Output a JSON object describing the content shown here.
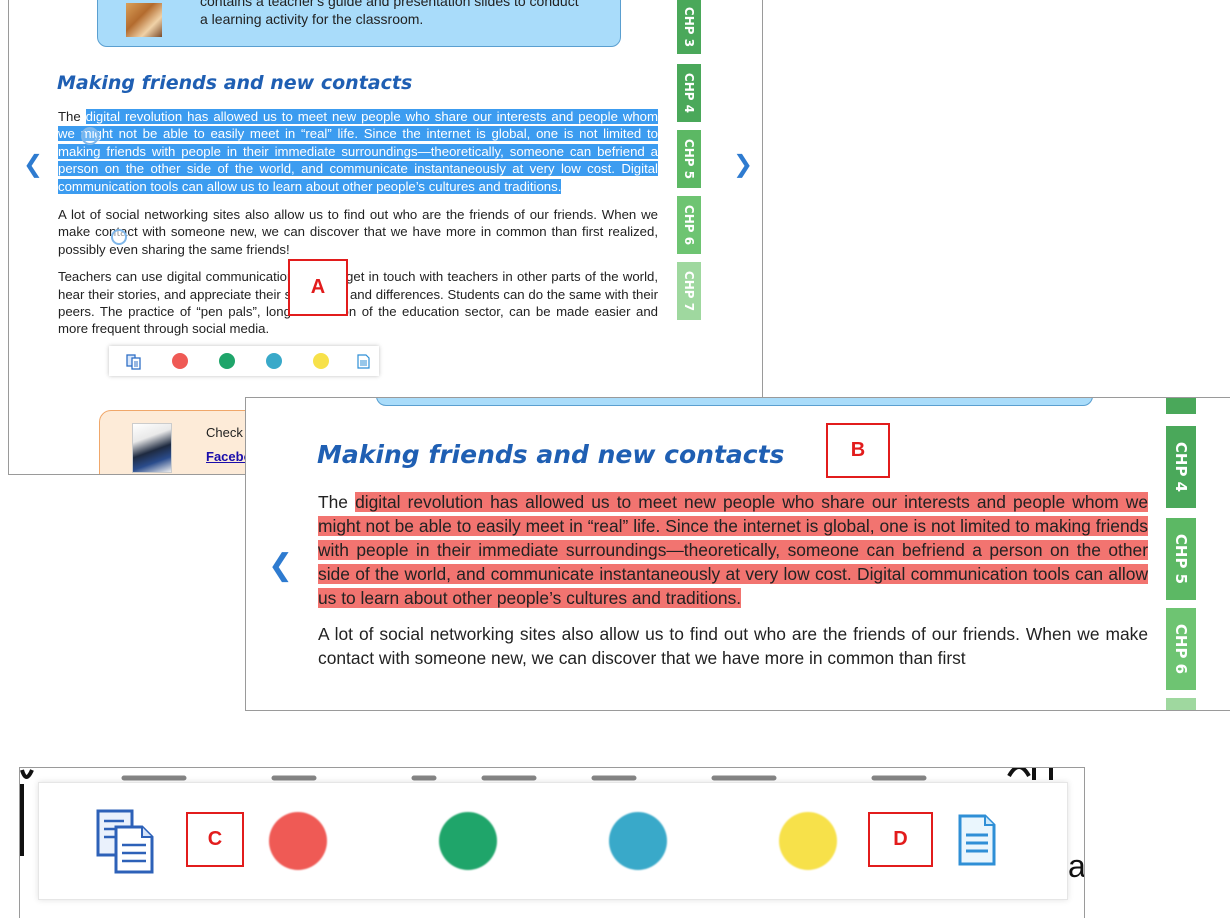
{
  "colors": {
    "title": "#1f5fb3",
    "highlight_blue": "#3c9cf0",
    "highlight_red": "#f27470",
    "chp_dark": "#4aa85a",
    "chp_light": "#8fd28f",
    "dot_red": "#ef5a55",
    "dot_green": "#1fa56a",
    "dot_teal": "#39a9c9",
    "dot_yellow": "#f7e14a",
    "label": "#e21c1c"
  },
  "panel_a": {
    "banner_line1": "contains a teacher's guide and presentation slides to conduct",
    "banner_line2": "a learning activity for the classroom.",
    "title": "Making friends and new contacts",
    "para1_pre": "The ",
    "para1_highlight": "digital revolution has allowed us to meet new people who share our interests and people whom we might not be able to easily meet in “real” life. Since the internet is global, one is not limited to making friends with people in their immediate surroundings—theoretically, someone can befriend a person on the other side of the world, and communicate instantaneously at very low cost. Digital communication tools can allow us to learn about other people’s cultures and traditions.",
    "para2": "A lot of social networking sites also allow us to find out who are the friends of our friends. When we make contact with someone new, we can discover that we have more in common than first realized, possibly even sharing the same friends!",
    "para3": "Teachers can use digital communication tools to get in touch with teachers in other parts of the world, hear their stories, and appreciate their similarities and differences. Students can do the same with their peers. The practice of “pen pals”, long a tradition of the education sector, can be made easier and more frequent through social media.",
    "bottom_text": "Check ou",
    "bottom_link": "Facebo",
    "chapters": [
      "CHP 3",
      "CHP 4",
      "CHP 5",
      "CHP 6",
      "CHP 7"
    ],
    "nav_left": "❮",
    "nav_right": "❯"
  },
  "panel_b": {
    "title": "Making friends and new contacts",
    "para1_pre": "The ",
    "para1_highlight": "digital revolution has allowed us to meet new people who share our interests and people whom we might not be able to easily meet in “real” life. Since the internet is global, one is not limited to making friends with people in their immediate surroundings—theoretically, someone can befriend a person on the other side of the world, and communicate instantaneously at very low cost. Digital communication tools can allow us to learn about other people’s cultures and traditions.",
    "para2": "A lot of social networking sites also allow us to find out who are the friends of our friends. When we make contact with someone new, we can discover that we have more in common than first",
    "chapters": [
      "CHP 4",
      "CHP 5",
      "CHP 6"
    ],
    "nav_left": "❮"
  },
  "labels": {
    "a": "A",
    "b": "B",
    "c": "C",
    "d": "D"
  },
  "icons": [
    "copy-icon",
    "red-highlight-icon",
    "green-highlight-icon",
    "teal-highlight-icon",
    "yellow-highlight-icon",
    "note-icon"
  ]
}
